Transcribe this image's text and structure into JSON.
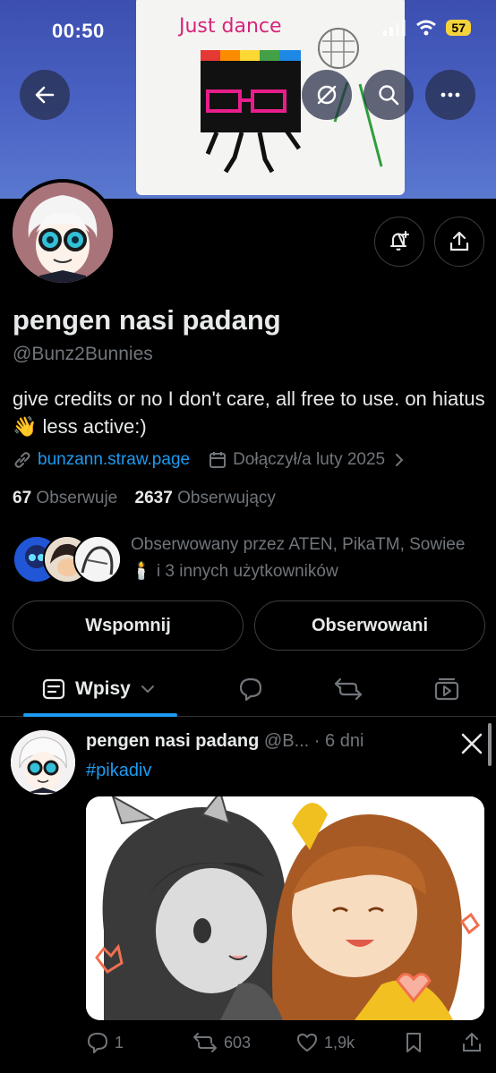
{
  "status": {
    "time": "00:50",
    "battery": "57"
  },
  "banner": {
    "drawing_text": "Just dance"
  },
  "profile": {
    "name": "pengen nasi padang",
    "handle": "@Bunz2Bunnies",
    "bio": "give credits or no I don't care, all free to use. on hiatus 👋 less active:)",
    "link": "bunzann.straw.page",
    "joined": "Dołączył/a luty 2025",
    "following_count": "67",
    "following_label": "Obserwuje",
    "followers_count": "2637",
    "followers_label": "Obserwujący",
    "followed_by": "Obserwowany przez ATEN, PikaTM, Sowiee🕯️ i 3 innych użytkowników"
  },
  "buttons": {
    "mention": "Wspomnij",
    "following": "Obserwowani"
  },
  "tabs": {
    "posts_label": "Wpisy"
  },
  "post": {
    "author": "pengen nasi padang",
    "handle": "@B...",
    "separator": "·",
    "time": "6 dni",
    "hashtag": "#pikadiv",
    "replies": "1",
    "reposts": "603",
    "likes": "1,9k"
  },
  "icons": [
    "back-arrow-icon",
    "hide-icon",
    "search-icon",
    "more-icon",
    "bell-plus-icon",
    "share-icon",
    "link-icon",
    "calendar-icon",
    "chevron-right-icon",
    "list-icon",
    "chevron-down-icon",
    "reply-icon",
    "repost-icon",
    "video-icon",
    "x-logo-icon",
    "like-icon",
    "bookmark-icon"
  ],
  "colors": {
    "accent": "#1d9bf0",
    "background": "#000000",
    "secondary_text": "#71767b",
    "banner": "#4a63c4"
  }
}
